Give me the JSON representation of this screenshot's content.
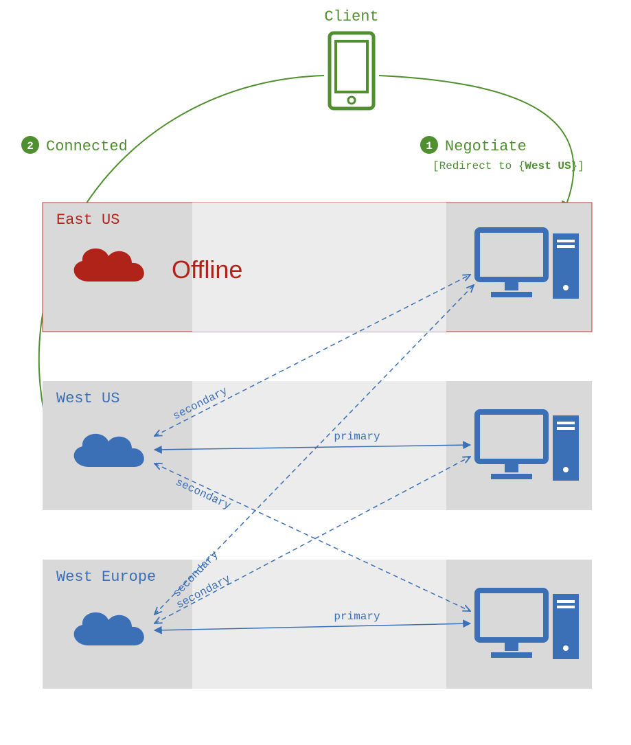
{
  "client": {
    "label": "Client"
  },
  "steps": {
    "negotiate": {
      "number": "1",
      "title": "Negotiate",
      "subtitle_prefix": "[Redirect to {",
      "subtitle_region": "West US",
      "subtitle_suffix": "}]"
    },
    "connected": {
      "number": "2",
      "title": "Connected"
    }
  },
  "regions": {
    "eastus": {
      "name": "East US",
      "status": "Offline"
    },
    "westus": {
      "name": "West US"
    },
    "westeurope": {
      "name": "West Europe"
    }
  },
  "connections": {
    "primary": "primary",
    "secondary": "secondary"
  },
  "colors": {
    "green": "#4F8F2F",
    "greenDark": "#3F7F20",
    "blue": "#3B6FB6",
    "red": "#B02318",
    "redBorder": "#C0392B",
    "panel": "#D9D9D9",
    "panelInner": "#ECECEC"
  }
}
